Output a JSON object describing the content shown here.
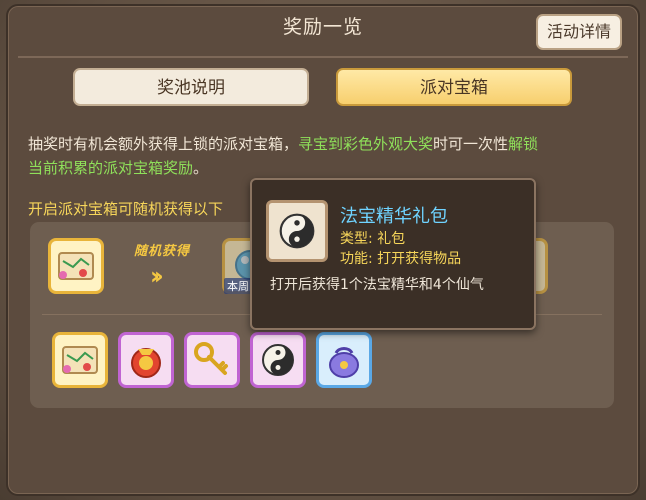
{
  "window": {
    "title": "奖励一览",
    "detail_button": "活动详情"
  },
  "tabs": [
    {
      "label": "奖池说明",
      "selected": false
    },
    {
      "label": "派对宝箱",
      "selected": true
    }
  ],
  "description": {
    "part1": "抽奖时有机会额外获得上锁的派对宝箱，",
    "part2_green": "寻宝到彩色外观大奖",
    "part3": "时可一次性",
    "part4_green": "解锁",
    "part5_green": "当前积累的派对宝箱奖励",
    "part6": "。"
  },
  "open_hint": "开启派对宝箱可随机获得以下",
  "rewards": {
    "random_label": "随机获得",
    "weekly_tag": "本周",
    "top_row": [
      "scroll-map",
      "crystal-orb",
      "gift-bag"
    ],
    "bottom_row": [
      "scroll-map",
      "red-pouch",
      "golden-key",
      "yin-yang-charm",
      "blue-gift-pouch"
    ]
  },
  "tooltip": {
    "name": "法宝精华礼包",
    "type": "类型: 礼包",
    "function": "功能: 打开获得物品",
    "description": "打开后获得1个法宝精华和4个仙气"
  },
  "colors": {
    "accent_gold": "#f5c842",
    "highlight_green": "#8fe05a",
    "tooltip_name": "#6fd3ff"
  }
}
